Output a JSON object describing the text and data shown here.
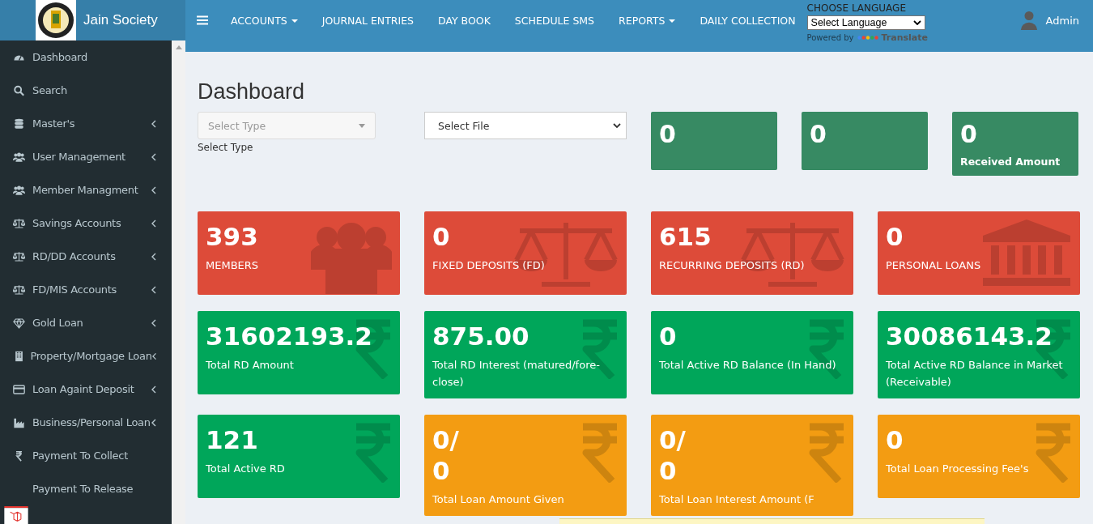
{
  "brand": {
    "name": "Jain Society"
  },
  "sidebar": {
    "items": [
      {
        "label": "Dashboard",
        "kind": "gauge",
        "expandable": false
      },
      {
        "label": "Search",
        "kind": "search",
        "expandable": false
      },
      {
        "label": "Master's",
        "kind": "database",
        "expandable": true
      },
      {
        "label": "User Management",
        "kind": "users",
        "expandable": true
      },
      {
        "label": "Member Managment",
        "kind": "users",
        "expandable": true
      },
      {
        "label": "Savings Accounts",
        "kind": "scale",
        "expandable": true
      },
      {
        "label": "RD/DD Accounts",
        "kind": "scale",
        "expandable": true
      },
      {
        "label": "FD/MIS Accounts",
        "kind": "scale",
        "expandable": true
      },
      {
        "label": "Gold Loan",
        "kind": "diamond",
        "expandable": true
      },
      {
        "label": "Property/Mortgage Loan",
        "kind": "building",
        "expandable": true
      },
      {
        "label": "Loan Againt Deposit",
        "kind": "card",
        "expandable": true
      },
      {
        "label": "Business/Personal Loan",
        "kind": "industry",
        "expandable": true
      },
      {
        "label": "Payment To Collect",
        "kind": "rupee",
        "expandable": false
      },
      {
        "label": "Payment To Release",
        "kind": "none",
        "expandable": false
      }
    ]
  },
  "navbar": {
    "menu": [
      {
        "label": "ACCOUNTS",
        "dropdown": true
      },
      {
        "label": "JOURNAL ENTRIES",
        "dropdown": false
      },
      {
        "label": "DAY BOOK",
        "dropdown": false
      },
      {
        "label": "SCHEDULE SMS",
        "dropdown": false
      },
      {
        "label": "REPORTS",
        "dropdown": true
      },
      {
        "label": "DAILY COLLECTION",
        "dropdown": false
      }
    ],
    "language": {
      "heading": "CHOOSE LANGUAGE",
      "value": "Select Language",
      "powered_by": "Powered by",
      "translate": "Translate"
    },
    "user": "Admin"
  },
  "page": {
    "title": "Dashboard",
    "type_select": {
      "placeholder": "Select Type",
      "caption": "Select Type"
    },
    "file_select": {
      "value": "Select File"
    },
    "summary": [
      {
        "value": "0"
      },
      {
        "value": "0"
      },
      {
        "value": "0",
        "label": "Received Amount"
      }
    ],
    "cards": [
      {
        "value": "393",
        "label": "MEMBERS",
        "color": "#dd4b39",
        "kind": "users"
      },
      {
        "value": "0",
        "label": "FIXED DEPOSITS (FD)",
        "color": "#dd4b39",
        "kind": "scale"
      },
      {
        "value": "615",
        "label": "RECURRING DEPOSITS (RD)",
        "color": "#dd4b39",
        "kind": "scale"
      },
      {
        "value": "0",
        "label": "PERSONAL LOANS",
        "color": "#dd4b39",
        "kind": "bank"
      },
      {
        "value": "31602193.2",
        "label": "Total RD Amount",
        "color": "#00a65a",
        "kind": "rupee"
      },
      {
        "value": "875.00",
        "label": "Total RD Interest (matured/fore-close)",
        "color": "#00a65a",
        "kind": "rupee"
      },
      {
        "value": "0",
        "label": "Total Active RD Balance (In Hand)",
        "color": "#00a65a",
        "kind": "rupee"
      },
      {
        "value": "30086143.2",
        "label": "Total Active RD Balance in Market (Receivable)",
        "color": "#00a65a",
        "kind": "rupee"
      },
      {
        "value": "121",
        "label": "Total Active RD",
        "color": "#00a65a",
        "kind": "rupee"
      },
      {
        "value": "0/\n0",
        "label": "Total Loan Amount Given",
        "color": "#f39c12",
        "kind": "rupee"
      },
      {
        "value": "0/\n0",
        "label": "Total Loan Interest Amount (F",
        "color": "#f39c12",
        "kind": "rupee"
      },
      {
        "value": "0",
        "label": "Total Loan Processing Fee's",
        "color": "#f39c12",
        "kind": "rupee"
      }
    ]
  }
}
